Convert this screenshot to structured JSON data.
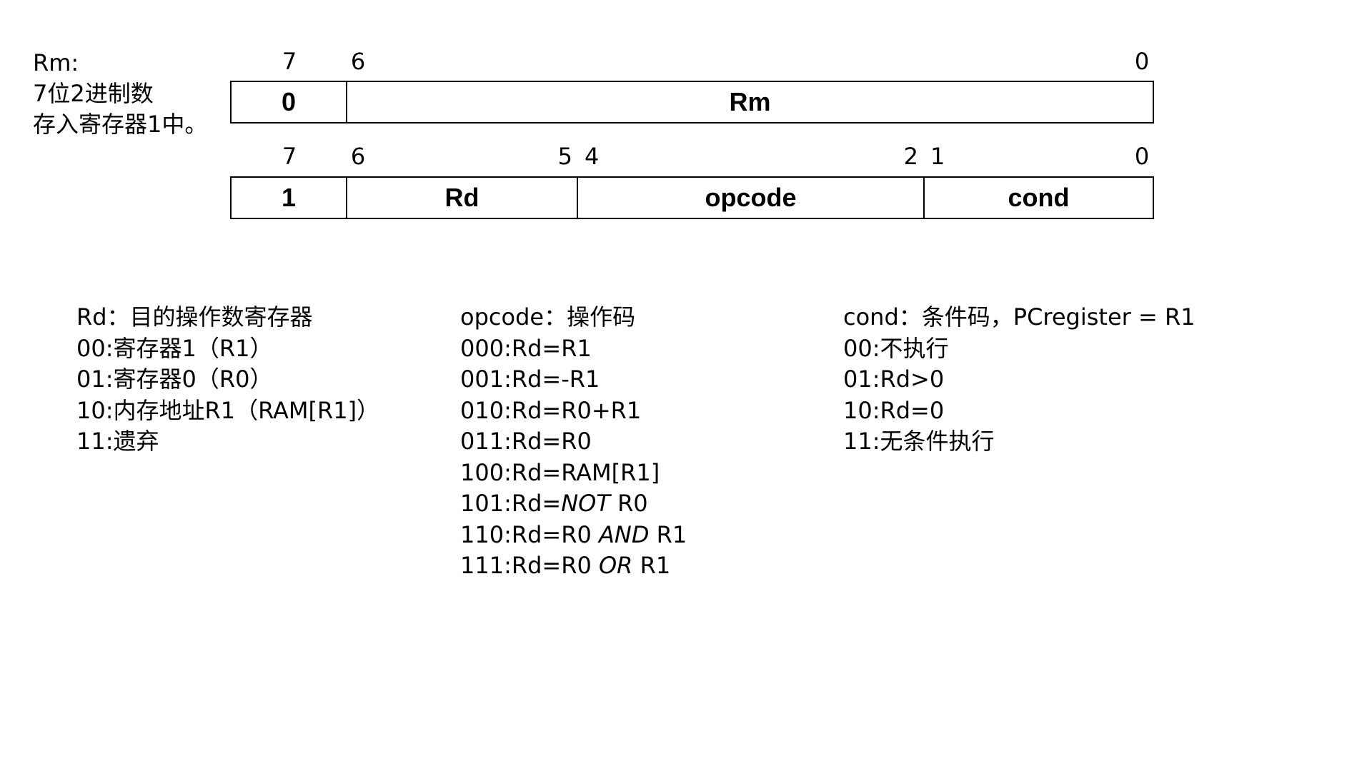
{
  "rm_note": [
    "Rm:",
    "7位2进制数",
    "存入寄存器1中。"
  ],
  "row1": {
    "bits": [
      "7",
      "6",
      "0"
    ],
    "fields": [
      "0",
      "Rm"
    ]
  },
  "row2": {
    "bits": [
      "7",
      "6",
      "5",
      "4",
      "2",
      "1",
      "0"
    ],
    "fields": [
      "1",
      "Rd",
      "opcode",
      "cond"
    ]
  },
  "rd_legend": {
    "title": "Rd：目的操作数寄存器",
    "items": [
      "00:寄存器1（R1）",
      "01:寄存器0（R0）",
      "10:内存地址R1（RAM[R1]）",
      "11:遗弃"
    ]
  },
  "opcode_legend": {
    "title": "opcode：操作码",
    "items": [
      {
        "pre": "000:Rd=R1",
        "op": "",
        "post": ""
      },
      {
        "pre": "001:Rd=-R1",
        "op": "",
        "post": ""
      },
      {
        "pre": "010:Rd=R0+R1",
        "op": "",
        "post": ""
      },
      {
        "pre": "011:Rd=R0",
        "op": "",
        "post": ""
      },
      {
        "pre": "100:Rd=RAM[R1]",
        "op": "",
        "post": ""
      },
      {
        "pre": "101:Rd=",
        "op": "NOT",
        "post": " R0"
      },
      {
        "pre": "110:Rd=R0 ",
        "op": "AND",
        "post": " R1"
      },
      {
        "pre": "111:Rd=R0 ",
        "op": "OR",
        "post": " R1"
      }
    ]
  },
  "cond_legend": {
    "title": "cond：条件码，PCregister = R1",
    "items": [
      "00:不执行",
      "01:Rd>0",
      "10:Rd=0",
      "11:无条件执行"
    ]
  }
}
